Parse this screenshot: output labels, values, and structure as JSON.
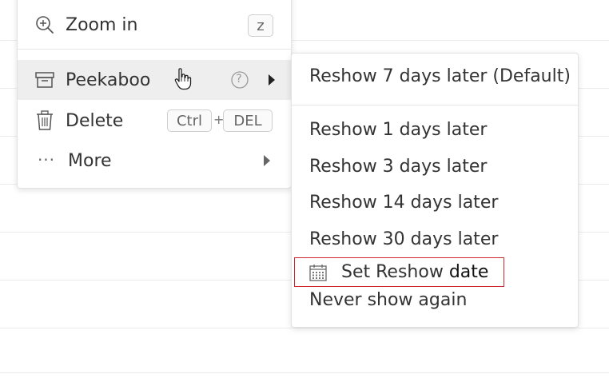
{
  "context_menu": {
    "zoom_in": {
      "label": "Zoom in",
      "shortcut": "z",
      "icon": "zoom-in-icon"
    },
    "peekaboo": {
      "label": "Peekaboo",
      "help_symbol": "?",
      "icon": "archive-box-icon"
    },
    "delete": {
      "label": "Delete",
      "shortcut_mod": "Ctrl",
      "shortcut_plus": "+",
      "shortcut_key": "DEL",
      "icon": "trash-icon"
    },
    "more": {
      "label": "More",
      "icon_glyph": "···",
      "icon": "ellipsis-icon"
    }
  },
  "submenu": {
    "default_option": "Reshow 7 days later (Default)",
    "options": [
      "Reshow 1 days later",
      "Reshow 3 days later",
      "Reshow 14 days later",
      "Reshow 30 days later"
    ],
    "set_date": {
      "label_prefix": "Set Reshow ",
      "label_emphasis": "date",
      "icon": "calendar-icon"
    },
    "never": "Never show again"
  },
  "colors": {
    "highlight_border": "#d0262f",
    "active_row_bg": "#eeeeee",
    "text": "#333333"
  }
}
